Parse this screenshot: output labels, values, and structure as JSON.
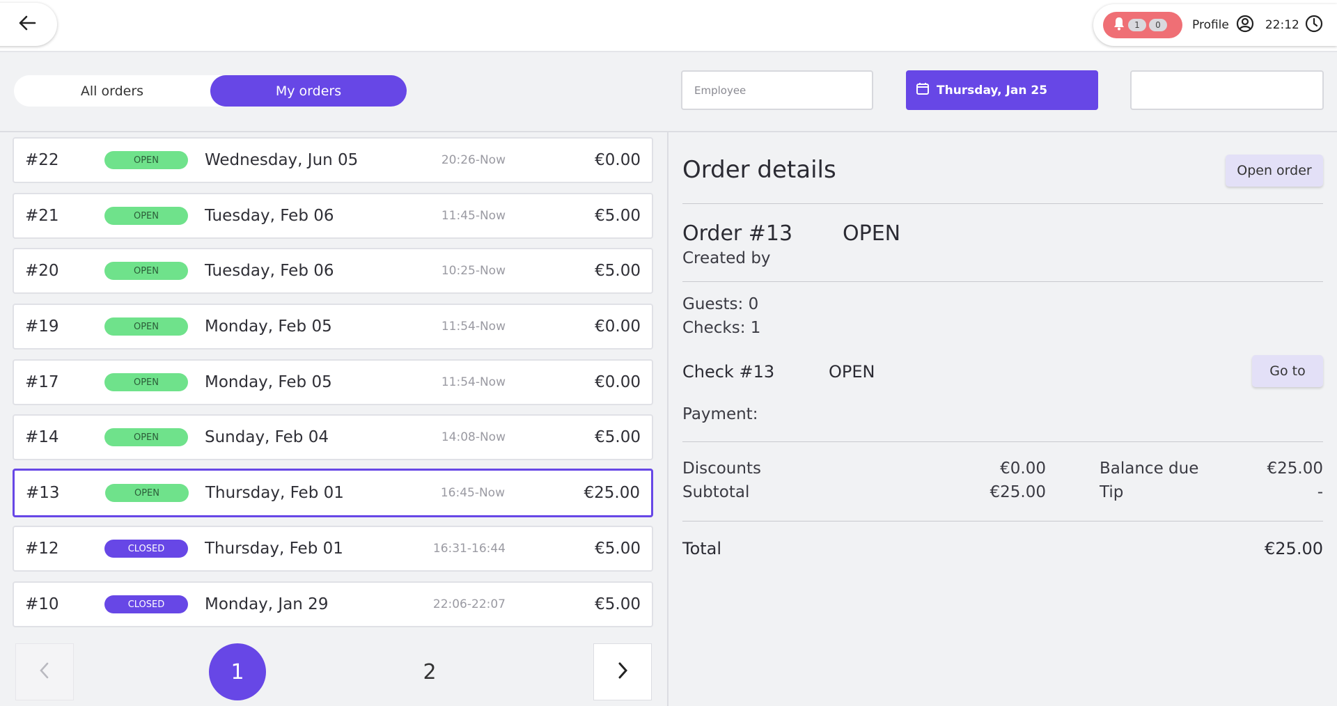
{
  "header": {
    "notifications": {
      "count_a": "1",
      "count_b": "0"
    },
    "profile_label": "Profile",
    "time": "22:12"
  },
  "filters": {
    "tabs": [
      {
        "label": "All orders",
        "active": false
      },
      {
        "label": "My orders",
        "active": true
      }
    ],
    "employee_placeholder": "Employee",
    "date_label": "Thursday, Jan 25"
  },
  "orders": [
    {
      "number": "#22",
      "status": "OPEN",
      "date": "Wednesday, Jun 05",
      "time": "20:26-Now",
      "amount": "€0.00"
    },
    {
      "number": "#21",
      "status": "OPEN",
      "date": "Tuesday, Feb 06",
      "time": "11:45-Now",
      "amount": "€5.00"
    },
    {
      "number": "#20",
      "status": "OPEN",
      "date": "Tuesday, Feb 06",
      "time": "10:25-Now",
      "amount": "€5.00"
    },
    {
      "number": "#19",
      "status": "OPEN",
      "date": "Monday, Feb 05",
      "time": "11:54-Now",
      "amount": "€0.00"
    },
    {
      "number": "#17",
      "status": "OPEN",
      "date": "Monday, Feb 05",
      "time": "11:54-Now",
      "amount": "€0.00"
    },
    {
      "number": "#14",
      "status": "OPEN",
      "date": "Sunday, Feb 04",
      "time": "14:08-Now",
      "amount": "€5.00"
    },
    {
      "number": "#13",
      "status": "OPEN",
      "date": "Thursday, Feb 01",
      "time": "16:45-Now",
      "amount": "€25.00",
      "selected": true
    },
    {
      "number": "#12",
      "status": "CLOSED",
      "date": "Thursday, Feb 01",
      "time": "16:31-16:44",
      "amount": "€5.00"
    },
    {
      "number": "#10",
      "status": "CLOSED",
      "date": "Monday, Jan 29",
      "time": "22:06-22:07",
      "amount": "€5.00"
    }
  ],
  "pagination": {
    "pages": [
      "1",
      "2"
    ],
    "current": "1"
  },
  "details": {
    "title": "Order details",
    "open_order_label": "Open order",
    "order_label": "Order #13",
    "order_status": "OPEN",
    "created_by": "Created by",
    "guests": "Guests: 0",
    "checks": "Checks: 1",
    "check_label": "Check #13",
    "check_status": "OPEN",
    "goto_label": "Go to",
    "payment_label": "Payment:",
    "discounts_label": "Discounts",
    "discounts_value": "€0.00",
    "subtotal_label": "Subtotal",
    "subtotal_value": "€25.00",
    "balance_label": "Balance due",
    "balance_value": "€25.00",
    "tip_label": "Tip",
    "tip_value": "-",
    "total_label": "Total",
    "total_value": "€25.00"
  },
  "colors": {
    "accent": "#6747e6",
    "open_badge": "#6fe28b",
    "notification": "#ef6f75"
  }
}
